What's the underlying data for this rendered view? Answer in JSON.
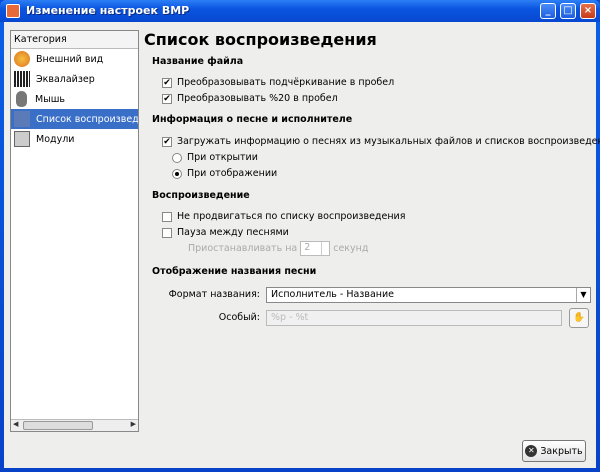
{
  "window": {
    "title": "Изменение настроек BMP"
  },
  "sidebar": {
    "header": "Категория",
    "items": [
      {
        "label": "Внешний вид",
        "icon": "palette-icon"
      },
      {
        "label": "Эквалайзер",
        "icon": "equalizer-icon"
      },
      {
        "label": "Мышь",
        "icon": "mouse-icon"
      },
      {
        "label": "Список воспроизведения",
        "icon": "playlist-icon",
        "selected": true
      },
      {
        "label": "Модули",
        "icon": "plugin-icon"
      }
    ]
  },
  "main": {
    "title": "Список воспроизведения",
    "file_name": {
      "heading": "Название файла",
      "underscore": "Преобразовывать подчёркивание в пробел",
      "percent20": "Преобразовывать %20 в пробел"
    },
    "song_info": {
      "heading": "Информация о песне и исполнителе",
      "load": "Загружать информацию о песнях из музыкальных файлов и списков воспроизведения",
      "on_open": "При открытии",
      "on_display": "При отображении"
    },
    "playback": {
      "heading": "Воспроизведение",
      "no_advance": "Не продвигаться по списку воспроизведения",
      "pause": "Пауза между песнями",
      "pause_for": "Приостанавливать на",
      "pause_value": "2",
      "seconds": "секунд"
    },
    "title_display": {
      "heading": "Отображение названия песни",
      "format_label": "Формат названия:",
      "format_value": "Исполнитель - Название",
      "custom_label": "Особый:",
      "custom_value": "%p - %t"
    }
  },
  "footer": {
    "close": "Закрыть"
  }
}
